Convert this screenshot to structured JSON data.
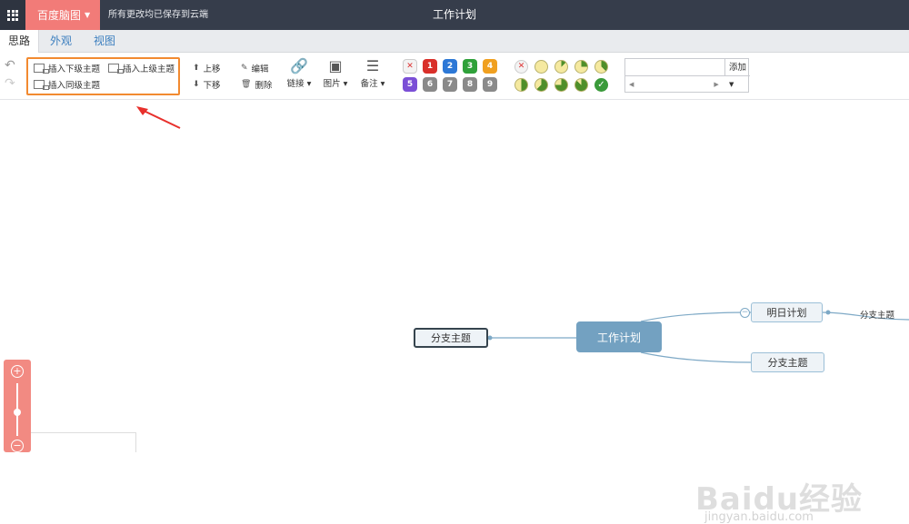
{
  "header": {
    "brand": "百度脑图",
    "saved_status": "所有更改均已保存到云端",
    "doc_title": "工作计划"
  },
  "tabs": [
    {
      "label": "思路",
      "active": true
    },
    {
      "label": "外观"
    },
    {
      "label": "视图"
    }
  ],
  "toolbar": {
    "insert_child": "插入下级主题",
    "insert_parent": "插入上级主题",
    "insert_sibling": "插入同级主题",
    "move_up": "上移",
    "move_down": "下移",
    "edit": "编辑",
    "delete": "删除",
    "link": "链接",
    "image": "图片",
    "note": "备注",
    "priorities": [
      "✕",
      "1",
      "2",
      "3",
      "4",
      "5",
      "6",
      "7",
      "8",
      "9"
    ],
    "priority_colors": [
      "#e04a4a",
      "#d9302a",
      "#2d78d6",
      "#2fa13a",
      "#f0a020",
      "#7b4fd6",
      "#8a8a8a",
      "#8a8a8a",
      "#8a8a8a",
      "#8a8a8a"
    ],
    "add_label": "添加"
  },
  "mindmap": {
    "root": "工作计划",
    "left_child": "分支主题",
    "right_children": [
      "明日计划",
      "分支主题"
    ],
    "leaf": "分支主题",
    "collapse_symbol": "−"
  },
  "zoom": {
    "in": "+",
    "out": "−"
  },
  "watermark": {
    "main": "Baidu经验",
    "url": "jingyan.baidu.com"
  }
}
